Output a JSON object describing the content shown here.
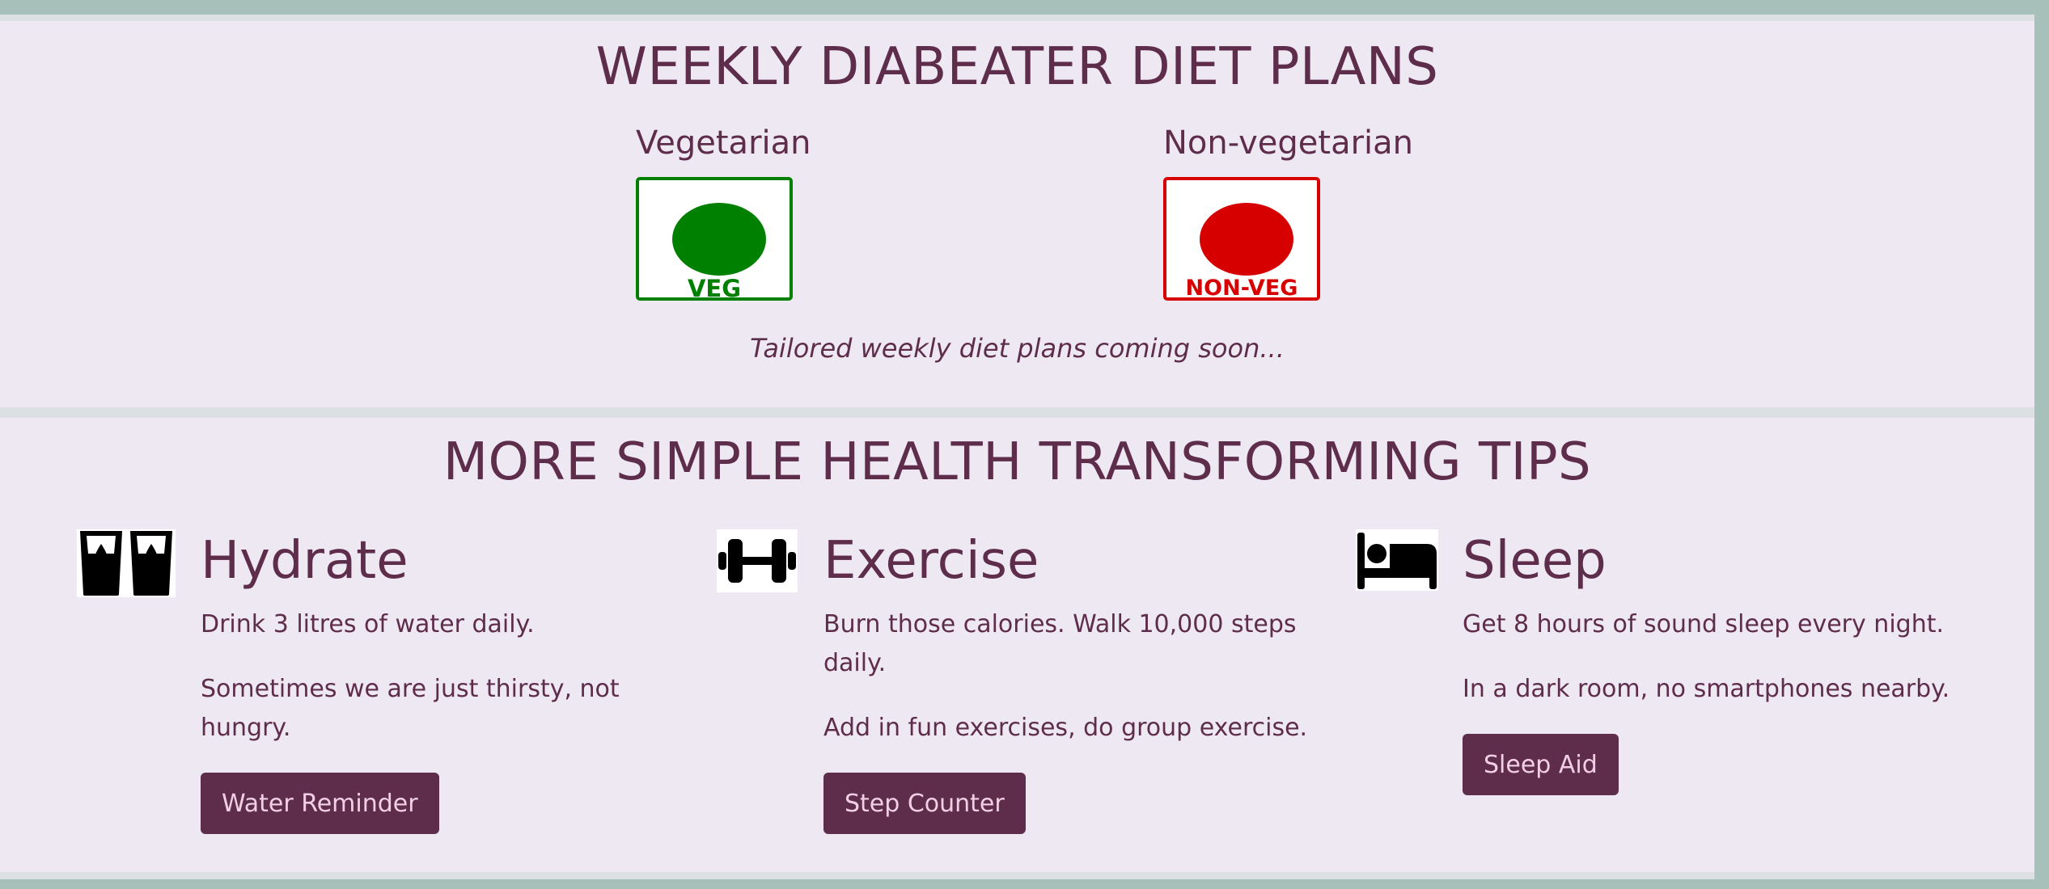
{
  "diet_plans": {
    "title": "WEEKLY DIABEATER DIET PLANS",
    "vegetarian": {
      "label": "Vegetarian",
      "badge_text": "VEG",
      "color": "#008000"
    },
    "non_vegetarian": {
      "label": "Non-vegetarian",
      "badge_text": "NON-VEG",
      "color": "#d70000"
    },
    "coming_soon": "Tailored weekly diet plans coming soon..."
  },
  "tips": {
    "title": "MORE SIMPLE HEALTH TRANSFORMING TIPS",
    "hydrate": {
      "icon": "water-glasses-icon",
      "title": "Hydrate",
      "line1": "Drink 3 litres of water daily.",
      "line2": "Sometimes we are just thirsty, not hungry.",
      "button": "Water Reminder"
    },
    "exercise": {
      "icon": "dumbbell-icon",
      "title": "Exercise",
      "line1": "Burn those calories. Walk 10,000 steps daily.",
      "line2": "Add in fun exercises, do group exercise.",
      "button": "Step Counter"
    },
    "sleep": {
      "icon": "bed-icon",
      "title": "Sleep",
      "line1": "Get 8 hours of sound sleep every night.",
      "line2": "In a dark room, no smartphones nearby.",
      "button": "Sleep Aid"
    }
  },
  "colors": {
    "primary": "#5e2d4c",
    "panel_bg": "#eee8f2",
    "page_bg": "#a7c1ba",
    "button_text": "#f2cfe3"
  }
}
